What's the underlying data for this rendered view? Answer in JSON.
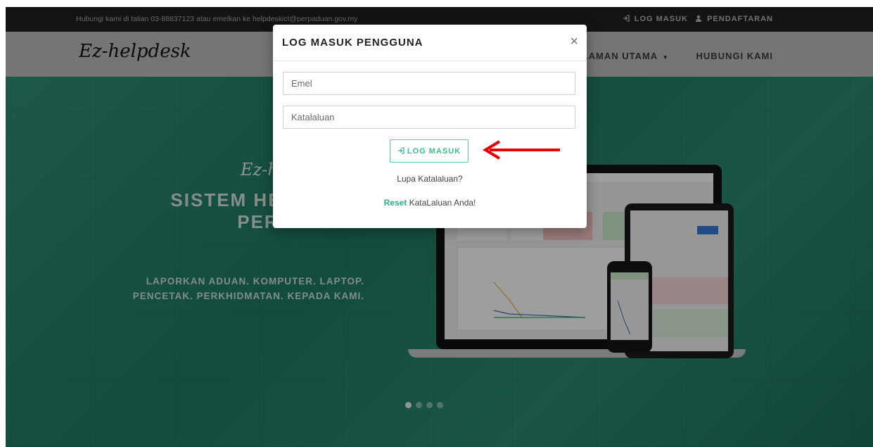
{
  "topbar": {
    "contact": "Hubungi kami di talian 03-88837123 atau emelkan ke helpdeskict@perpaduan.gov.my",
    "login_label": "LOG MASUK",
    "register_label": "PENDAFTARAN"
  },
  "navbar": {
    "brand": "Ez-helpdesk",
    "home_label": "LAMAN UTAMA",
    "contact_label": "HUBUNGI KAMI"
  },
  "hero": {
    "brand": "Ez-helpdesk",
    "title": "SISTEM HELPDESK PERPADUAN",
    "subtitle": "LAPORKAN ADUAN. KOMPUTER. LAPTOP. PENCETAK. PERKHIDMATAN. KEPADA KAMI."
  },
  "carousel": {
    "slide_count": 4,
    "active_index": 0
  },
  "modal": {
    "title": "LOG MASUK PENGGUNA",
    "close_symbol": "×",
    "email_placeholder": "Emel",
    "password_placeholder": "Katalaluan",
    "login_button": "LOG MASUK",
    "forgot_text": "Lupa Katalaluan?",
    "reset_link": "Reset",
    "reset_rest": "KataLaluan Anda!"
  },
  "colors": {
    "accent": "#3fb891",
    "arrow": "#e60000",
    "hero_base": "#1e7a64",
    "topbar": "#202020"
  },
  "icons": {
    "login": "sign-in-icon",
    "register": "user-icon",
    "close": "close-icon",
    "dropdown": "caret-down-icon"
  }
}
